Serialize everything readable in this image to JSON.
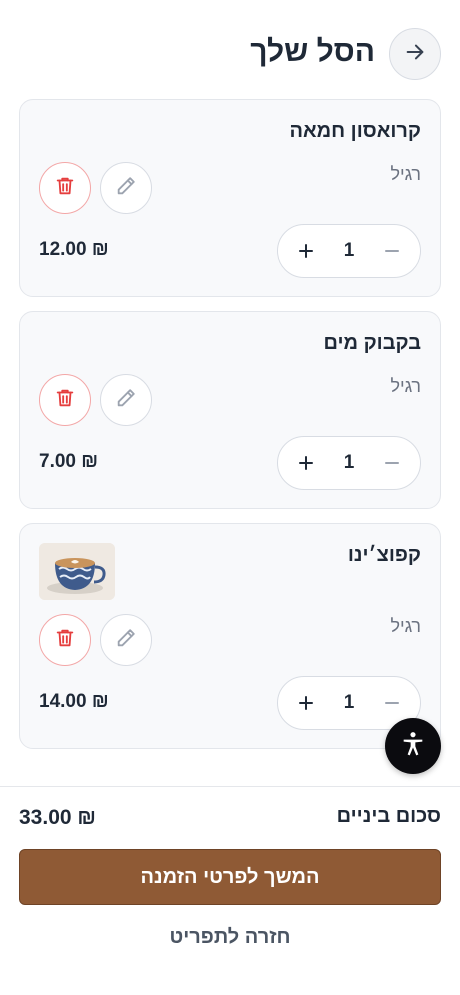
{
  "header": {
    "title": "הסל שלך",
    "back_icon": "arrow-right-icon"
  },
  "cart": {
    "items": [
      {
        "name": "קרואסון חמאה",
        "variant": "רגיל",
        "quantity": "1",
        "price": "₪ 12.00",
        "has_image": false
      },
      {
        "name": "בקבוק מים",
        "variant": "רגיל",
        "quantity": "1",
        "price": "₪ 7.00",
        "has_image": false
      },
      {
        "name": "קפוצ׳ינו",
        "variant": "רגיל",
        "quantity": "1",
        "price": "₪ 14.00",
        "has_image": true,
        "image_icon": "coffee-cup-image"
      }
    ]
  },
  "summary": {
    "subtotal_label": "סכום ביניים",
    "subtotal_value": "₪ 33.00"
  },
  "actions": {
    "checkout_label": "המשך לפרטי הזמנה",
    "back_to_menu_label": "חזרה לתפריט"
  },
  "accessibility": {
    "icon": "accessibility-icon"
  },
  "colors": {
    "primary": "#8f5a35",
    "delete": "#e53e3e",
    "card_bg": "#f8f9fb",
    "a11y_bg": "#0b0b0f"
  }
}
